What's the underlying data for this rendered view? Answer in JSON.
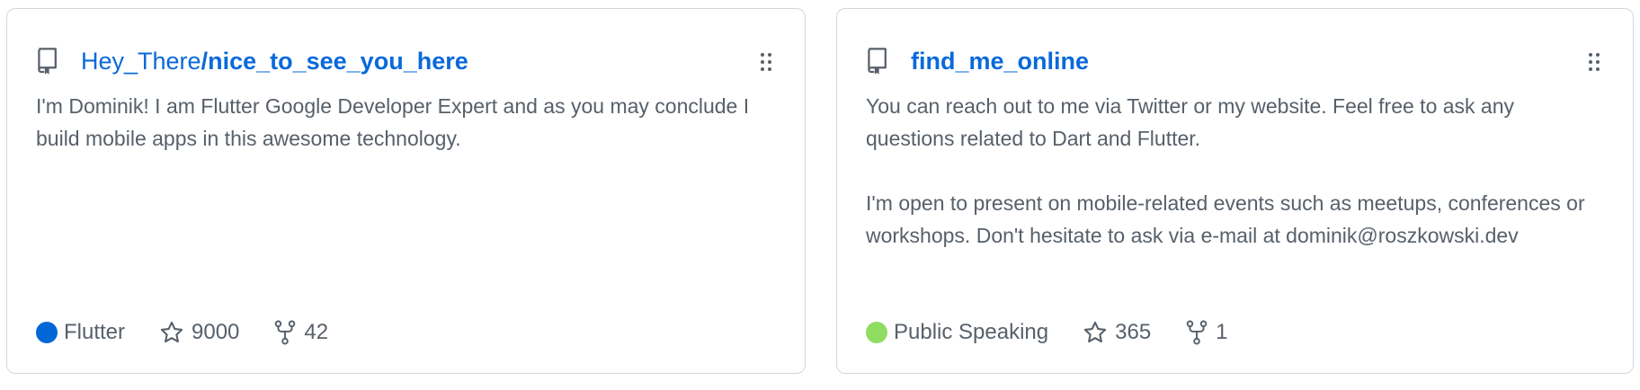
{
  "colors": {
    "link": "#0969da",
    "text_muted": "#57606a",
    "border": "#d0d7de"
  },
  "cards": [
    {
      "icon": "repo-icon",
      "owner": "Hey_There",
      "repo_name": "/nice_to_see_you_here",
      "description": "I'm Dominik! I am Flutter Google Developer Expert and as you may conclude I build mobile apps in this awesome technology.",
      "language": "Flutter",
      "language_color": "#0366d6",
      "stars": "9000",
      "forks": "42",
      "handle_icon": "drag-handle-icon"
    },
    {
      "icon": "repo-icon",
      "owner": "",
      "repo_name": "find_me_online",
      "description": "You can reach out to me via Twitter or my website. Feel free to ask any questions related to Dart and Flutter.\n\nI'm open to present on mobile-related events such as meetups, conferences or workshops. Don't hesitate to ask via e-mail at dominik@roszkowski.dev",
      "language": "Public Speaking",
      "language_color": "#8fdc63",
      "stars": "365",
      "forks": "1",
      "handle_icon": "drag-handle-icon"
    }
  ]
}
